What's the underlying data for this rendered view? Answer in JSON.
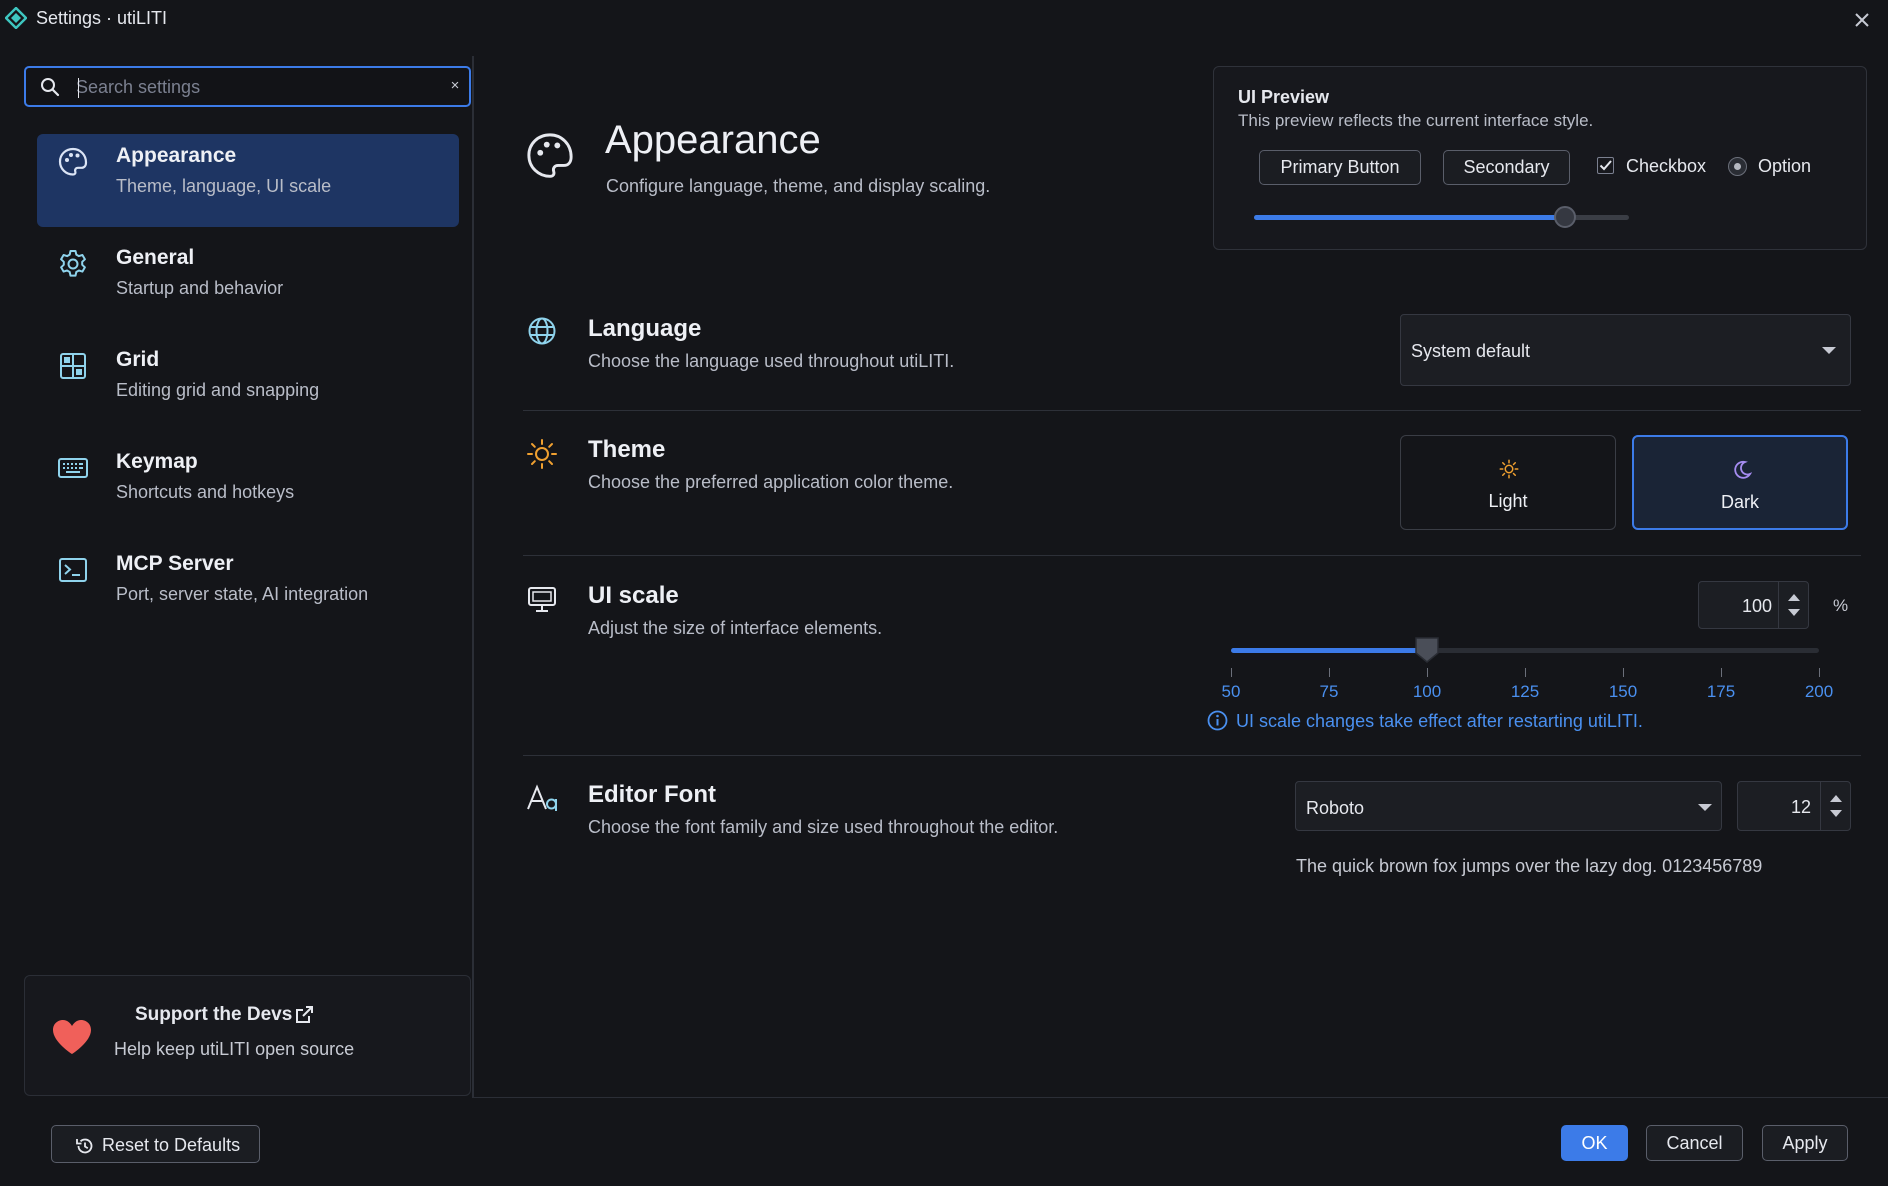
{
  "window": {
    "title": "Settings · utiLITI"
  },
  "search": {
    "placeholder": "Search settings",
    "value": "",
    "clear_label": "×"
  },
  "sidebar": {
    "items": [
      {
        "title": "Appearance",
        "subtitle": "Theme, language, UI scale",
        "icon": "palette-icon",
        "active": true
      },
      {
        "title": "General",
        "subtitle": "Startup and behavior",
        "icon": "gear-icon",
        "active": false
      },
      {
        "title": "Grid",
        "subtitle": "Editing grid and snapping",
        "icon": "grid-icon",
        "active": false
      },
      {
        "title": "Keymap",
        "subtitle": "Shortcuts and hotkeys",
        "icon": "keyboard-icon",
        "active": false
      },
      {
        "title": "MCP Server",
        "subtitle": "Port, server state, AI integration",
        "icon": "terminal-icon",
        "active": false
      }
    ],
    "support": {
      "title": "Support the Devs",
      "subtitle": "Help keep utiLITI open source",
      "icon": "heart-icon"
    }
  },
  "header": {
    "title": "Appearance",
    "subtitle": "Configure language, theme, and display scaling."
  },
  "preview": {
    "title": "UI Preview",
    "description": "This preview reflects the current interface style.",
    "primary_label": "Primary Button",
    "secondary_label": "Secondary",
    "checkbox_label": "Checkbox",
    "checkbox_checked": true,
    "radio_label": "Option",
    "slider_value": 0.83
  },
  "language": {
    "title": "Language",
    "description": "Choose the language used throughout utiLITI.",
    "value": "System default"
  },
  "theme": {
    "title": "Theme",
    "description": "Choose the preferred application color theme.",
    "options": [
      {
        "label": "Light",
        "icon": "sun-icon",
        "selected": false
      },
      {
        "label": "Dark",
        "icon": "moon-icon",
        "selected": true
      }
    ]
  },
  "ui_scale": {
    "title": "UI scale",
    "description": "Adjust the size of interface elements.",
    "value": "100",
    "unit": "%",
    "min": 50,
    "max": 200,
    "ticks": [
      "50",
      "75",
      "100",
      "125",
      "150",
      "175",
      "200"
    ],
    "note": "UI scale changes take effect after restarting utiLITI."
  },
  "editor_font": {
    "title": "Editor Font",
    "description": "Choose the font family and size used throughout the editor.",
    "family": "Roboto",
    "size": "12",
    "preview_text": "The quick brown fox jumps over the lazy dog. 0123456789"
  },
  "footer": {
    "reset_label": "Reset to Defaults",
    "ok_label": "OK",
    "cancel_label": "Cancel",
    "apply_label": "Apply"
  },
  "colors": {
    "background": "#141519",
    "accent": "#3c7be8",
    "active_nav": "#1e3563",
    "link_blue": "#4a90f0",
    "icon_cyan": "#8fd3ec",
    "sun_orange": "#f0a030",
    "moon_purple": "#a58cf0",
    "heart_red": "#f0605a"
  }
}
